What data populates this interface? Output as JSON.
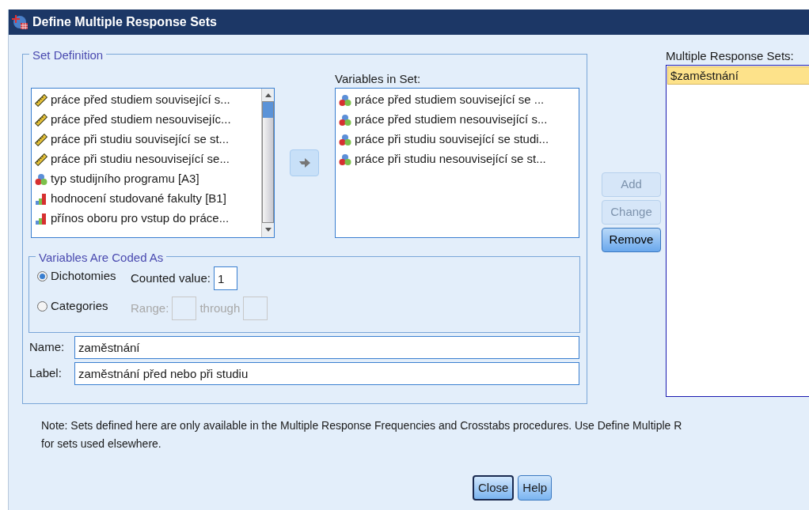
{
  "window": {
    "title": "Define Multiple Response Sets"
  },
  "set_definition": {
    "title": "Set Definition",
    "source_variables": [
      {
        "kind": "scale",
        "label": "práce před studiem související s...",
        "selected": false
      },
      {
        "kind": "scale",
        "label": "práce před studiem nesouvisejíc...",
        "selected": false
      },
      {
        "kind": "scale",
        "label": "práce při studiu související se st...",
        "selected": false
      },
      {
        "kind": "scale",
        "label": "práce při studiu nesouvisející se...",
        "selected": false
      },
      {
        "kind": "nominal",
        "label": "typ studijního programu [A3]",
        "selected": false
      },
      {
        "kind": "ordinal",
        "label": "hodnocení studované fakulty [B1]",
        "selected": false
      },
      {
        "kind": "ordinal",
        "label": "přínos oboru pro vstup do práce...",
        "selected": false
      }
    ],
    "variables_in_set_label": "Variables in Set:",
    "variables_in_set": [
      {
        "kind": "nominal",
        "label": "práce před studiem související se ...",
        "selected": false
      },
      {
        "kind": "nominal",
        "label": "práce před studiem nesouvisející s...",
        "selected": false
      },
      {
        "kind": "nominal",
        "label": "práce při studiu související se studi...",
        "selected": false
      },
      {
        "kind": "nominal",
        "label": "práce při studiu nesouvisející se st...",
        "selected": false
      }
    ],
    "coded_as": {
      "title": "Variables Are Coded As",
      "options": [
        {
          "label": "Dichotomies",
          "selected": true
        },
        {
          "label": "Categories",
          "selected": false
        }
      ],
      "counted_value": {
        "label": "Counted value:",
        "value": "1",
        "disabled": false
      },
      "range": {
        "label": "Range:",
        "through_label": "through",
        "disabled": true
      }
    },
    "name": {
      "label": "Name:",
      "value": "zaměstnání"
    },
    "label": {
      "label": "Label:",
      "value": "zaměstnání před nebo při studiu"
    }
  },
  "actions": [
    {
      "label": "Add",
      "disabled": true
    },
    {
      "label": "Change",
      "disabled": true
    },
    {
      "label": "Remove",
      "disabled": false
    }
  ],
  "response_sets": {
    "label": "Multiple Response Sets:",
    "items": [
      {
        "label": "$zaměstnání",
        "selected": true
      }
    ]
  },
  "note_lines": [
    "Note: Sets defined here are only available in the Multiple Response Frequencies and Crosstabs procedures. Use Define Multiple R",
    "for sets used elsewhere."
  ],
  "buttons": [
    {
      "label": "Close",
      "default": true
    },
    {
      "label": "Help",
      "default": false
    }
  ]
}
